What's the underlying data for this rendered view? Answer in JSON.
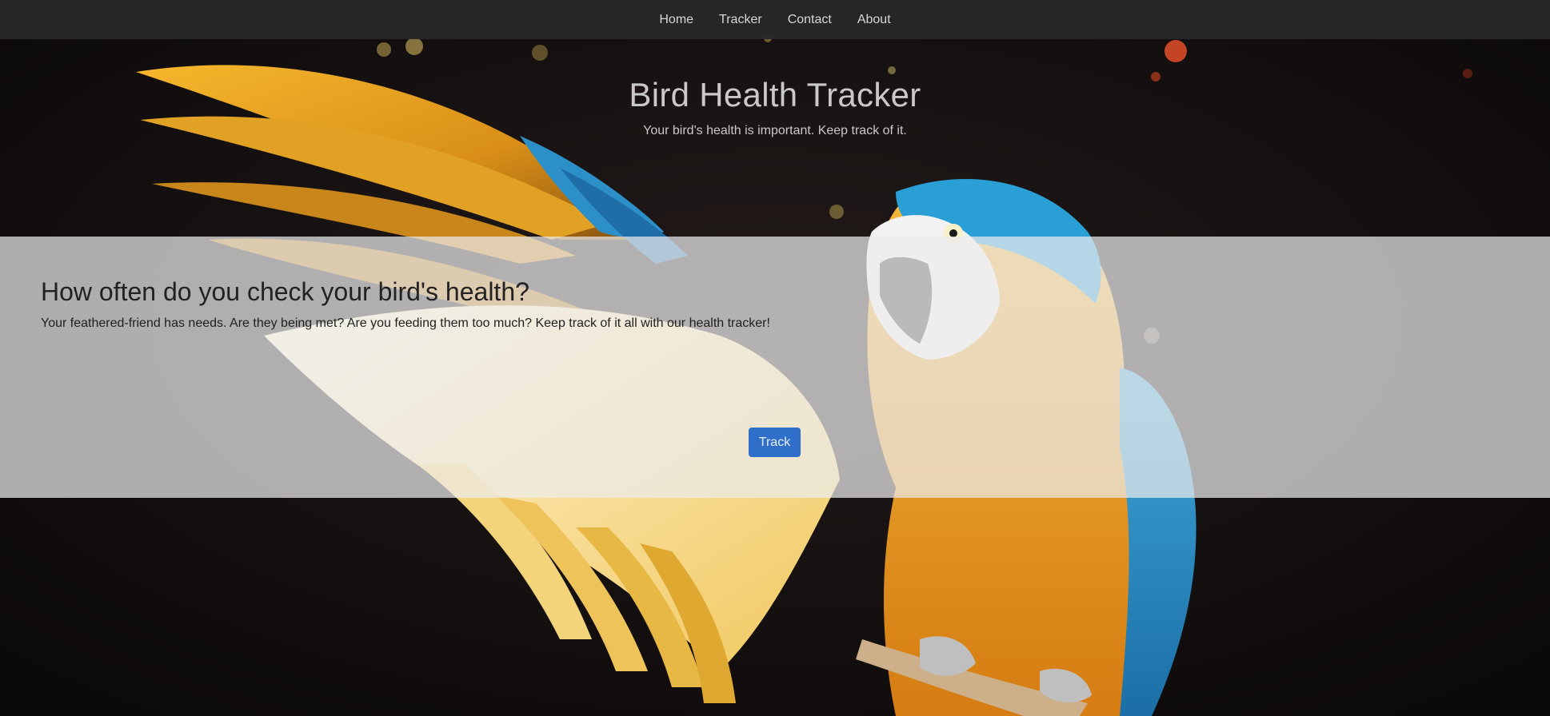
{
  "nav": {
    "items": [
      {
        "label": "Home"
      },
      {
        "label": "Tracker"
      },
      {
        "label": "Contact"
      },
      {
        "label": "About"
      }
    ]
  },
  "hero": {
    "title": "Bird Health Tracker",
    "subtitle": "Your bird's health is important. Keep track of it."
  },
  "panel": {
    "heading": "How often do you check your bird's health?",
    "text": "Your feathered-friend has needs. Are they being met? Are you feeding them too much? Keep track of it all with our health tracker!",
    "button_label": "Track"
  },
  "colors": {
    "navbar": "#28282a",
    "button": "#2f6fca",
    "panel_overlay": "#ebebeb"
  }
}
